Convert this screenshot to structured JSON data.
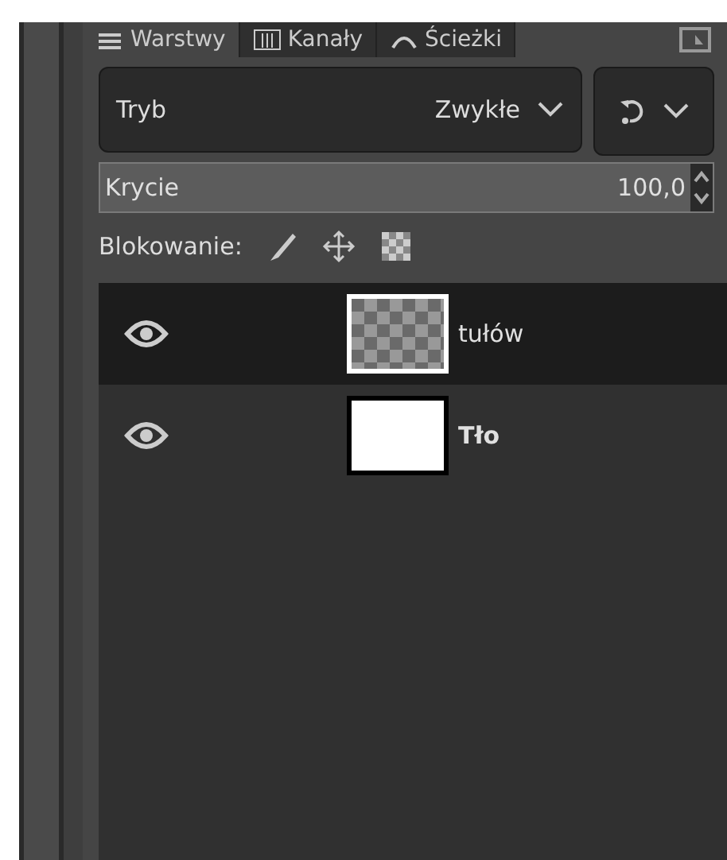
{
  "tabs": [
    {
      "label": "Warstwy",
      "selected": true
    },
    {
      "label": "Kanały",
      "selected": false
    },
    {
      "label": "Ścieżki",
      "selected": false
    }
  ],
  "mode": {
    "label": "Tryb",
    "value": "Zwykłe"
  },
  "opacity": {
    "label": "Krycie",
    "value": "100,0",
    "level": 1
  },
  "lock": {
    "label": "Blokowanie:"
  },
  "layers": [
    {
      "name": "tułów",
      "visible": true,
      "selected": true,
      "bold": false,
      "kind": "transparent"
    },
    {
      "name": "Tło",
      "visible": true,
      "selected": false,
      "bold": true,
      "kind": "white"
    }
  ]
}
